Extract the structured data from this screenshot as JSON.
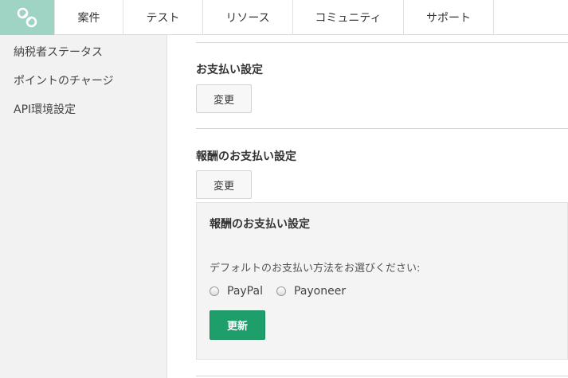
{
  "header": {
    "logo_icon": "knot-logo-icon",
    "tabs": [
      {
        "label": "案件"
      },
      {
        "label": "テスト"
      },
      {
        "label": "リソース"
      },
      {
        "label": "コミュニティ"
      },
      {
        "label": "サポート"
      }
    ]
  },
  "sidebar": {
    "items": [
      {
        "label": "納税者ステータス"
      },
      {
        "label": "ポイントのチャージ"
      },
      {
        "label": "API環境設定"
      }
    ]
  },
  "main": {
    "payment_section": {
      "title": "お支払い設定",
      "button_label": "変更"
    },
    "reward_section": {
      "title": "報酬のお支払い設定",
      "button_label": "変更",
      "panel": {
        "title": "報酬のお支払い設定",
        "description": "デフォルトのお支払い方法をお選びください:",
        "options": [
          {
            "label": "PayPal",
            "selected": false
          },
          {
            "label": "Payoneer",
            "selected": false
          }
        ],
        "submit_label": "更新"
      }
    }
  },
  "colors": {
    "logo_bg": "#9fd3c4",
    "sidebar_bg": "#f2f2f2",
    "panel_bg": "#f4f4f4",
    "primary_button": "#1e9e6b"
  }
}
